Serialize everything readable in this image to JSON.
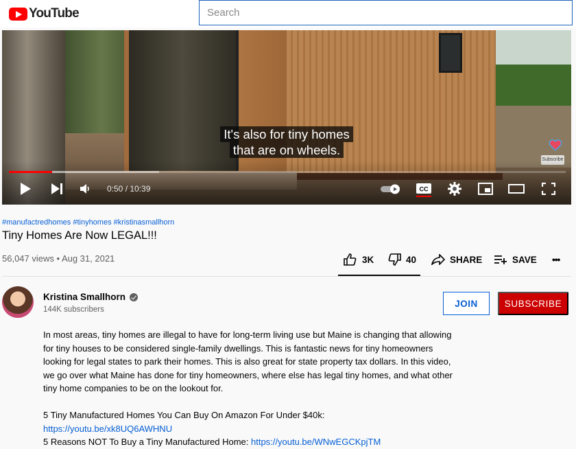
{
  "header": {
    "logo_text": "YouTube",
    "search_placeholder": "Search"
  },
  "player": {
    "caption_line1": "It's also for tiny homes",
    "caption_line2": "that are on wheels.",
    "time_display": "0:50 / 10:39",
    "progress_fraction": 0.078,
    "buffered_fraction": 0.27,
    "subscribe_badge": "Subscribe",
    "accent_color": "#ff0000"
  },
  "video": {
    "hashtags": "#manufactredhomes #tinyhomes #kristinasmallhorn",
    "title": "Tiny Homes Are Now LEGAL!!!",
    "views_date": "56,047 views • Aug 31, 2021",
    "likes": "3K",
    "dislikes": "40",
    "share_label": "SHARE",
    "save_label": "SAVE",
    "more_label": "•••"
  },
  "channel": {
    "name": "Kristina Smallhorn",
    "subscribers": "144K subscribers",
    "join_label": "JOIN",
    "subscribe_label": "SUBSCRIBE",
    "subscribe_color": "#cc0000"
  },
  "description": {
    "para1": "In most areas, tiny homes are illegal to have for long-term living use but Maine is changing that allowing for tiny houses to be considered single-family dwellings. This is fantastic news for tiny homeowners looking for legal states to park their homes. This is also great for state property tax dollars. In this video, we go over what Maine has done for tiny homeowners, where else has legal tiny homes, and what other tiny home companies to be on the lookout for.",
    "line1": "5 Tiny Manufactured Homes You Can Buy On Amazon For Under $40k:",
    "link1": "https://youtu.be/xk8UQ6AWHNU",
    "line2": "5 Reasons NOT To Buy a Tiny Manufactured Home: ",
    "link2": "https://youtu.be/WNwEGCKpjTM"
  },
  "icons": [
    "youtube-logo-icon",
    "play-icon",
    "next-icon",
    "volume-icon",
    "autoplay-toggle-icon",
    "captions-icon",
    "settings-gear-icon",
    "miniplayer-icon",
    "theater-icon",
    "fullscreen-icon",
    "like-icon",
    "dislike-icon",
    "share-icon",
    "save-playlist-icon",
    "more-icon",
    "verified-icon"
  ]
}
